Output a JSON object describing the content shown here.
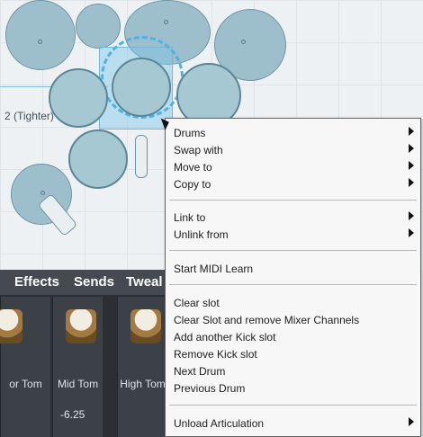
{
  "canvas": {
    "slot_label": "2 (Tighter)"
  },
  "mixer": {
    "tabs": [
      "Effects",
      "Sends",
      "Tweal"
    ],
    "channels": [
      {
        "label": "or Tom",
        "value": ""
      },
      {
        "label": "Mid Tom",
        "value": "-6.25"
      },
      {
        "label": "High Tom",
        "value": ""
      }
    ]
  },
  "context_menu": {
    "items": [
      {
        "label": "Drums",
        "submenu": true
      },
      {
        "label": "Swap with",
        "submenu": true
      },
      {
        "label": "Move to",
        "submenu": true
      },
      {
        "label": "Copy to",
        "submenu": true
      },
      {
        "label": "Link to",
        "submenu": true
      },
      {
        "label": "Unlink from",
        "submenu": true
      },
      {
        "label": "Start MIDI Learn",
        "submenu": false
      },
      {
        "label": "Clear slot",
        "submenu": false
      },
      {
        "label": "Clear Slot and remove Mixer Channels",
        "submenu": false
      },
      {
        "label": "Add another Kick slot",
        "submenu": false
      },
      {
        "label": "Remove Kick slot",
        "submenu": false
      },
      {
        "label": "Next Drum",
        "submenu": false
      },
      {
        "label": "Previous Drum",
        "submenu": false
      },
      {
        "label": "Unload Articulation",
        "submenu": true
      }
    ]
  },
  "colors": {
    "drum_fill": "#9dbfcb",
    "selection_ring": "#4fb1e6",
    "mixer_bg": "#2b2f33"
  }
}
